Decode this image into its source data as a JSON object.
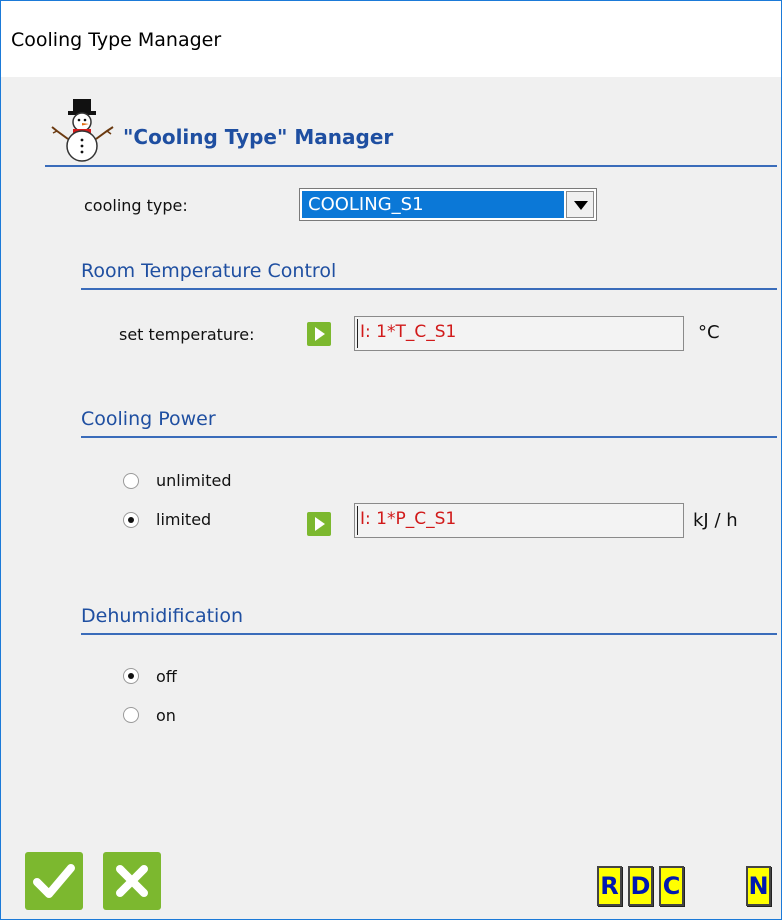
{
  "window": {
    "title": "Cooling Type Manager"
  },
  "header": {
    "title": "\"Cooling Type\" Manager",
    "icon": "snowman-icon"
  },
  "cooling_type": {
    "label": "cooling type:",
    "selected": "COOLING_S1"
  },
  "room_temperature": {
    "section_title": "Room Temperature Control",
    "set_temperature_label": "set temperature:",
    "set_temperature_value": "I: 1*T_C_S1",
    "unit": "°C"
  },
  "cooling_power": {
    "section_title": "Cooling Power",
    "options": [
      {
        "label": "unlimited",
        "checked": false
      },
      {
        "label": "limited",
        "checked": true
      }
    ],
    "value": "I: 1*P_C_S1",
    "unit": "kJ / h"
  },
  "dehumidification": {
    "section_title": "Dehumidification",
    "options": [
      {
        "label": "off",
        "checked": true
      },
      {
        "label": "on",
        "checked": false
      }
    ]
  },
  "footer": {
    "ok_icon": "checkmark-icon",
    "cancel_icon": "x-icon",
    "buttons": [
      "R",
      "D",
      "C",
      "N"
    ]
  },
  "colors": {
    "accent": "#1f4fa1",
    "green": "#7cb82f",
    "selection": "#0b78d7",
    "value_text": "#d11a1a",
    "yellow": "#ffff00"
  }
}
